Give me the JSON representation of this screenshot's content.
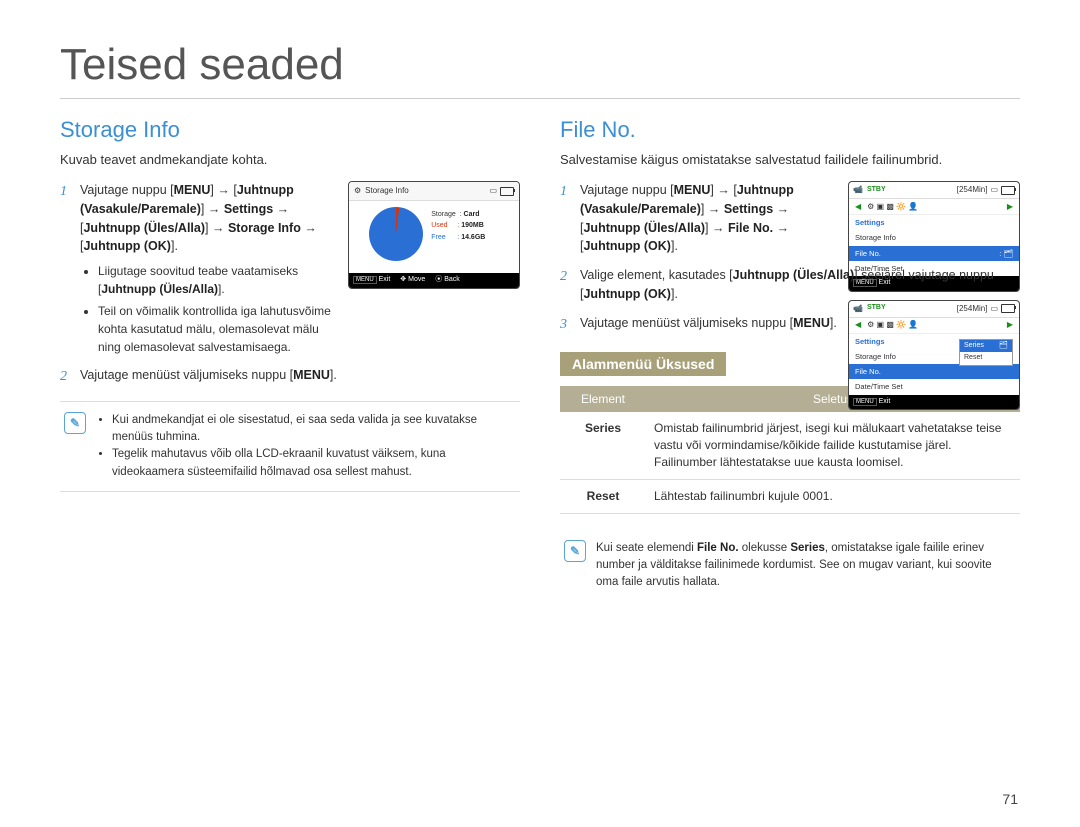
{
  "page_title": "Teised seaded",
  "page_number": "71",
  "left": {
    "heading": "Storage Info",
    "desc": "Kuvab teavet andmekandjate kohta.",
    "step1_a": "Vajutage nuppu [",
    "step1_menu": "MENU",
    "step1_b": "] → [",
    "step1_ctrl": "Juhtnupp (Vasakule/Paremale)",
    "step1_c": "] → ",
    "step1_settings": "Settings",
    "step1_d": " → [",
    "step1_ctrl2": "Juhtnupp (Üles/Alla)",
    "step1_e": "] → ",
    "step1_storage": "Storage Info",
    "step1_f": " → [",
    "step1_ok": "Juhtnupp (OK)",
    "step1_g": "].",
    "bullet1_a": "Liigutage soovitud teabe vaatamiseks [",
    "bullet1_b": "Juhtnupp (Üles/Alla)",
    "bullet1_c": "].",
    "bullet2": "Teil on võimalik kontrollida iga lahutusvõime kohta kasutatud mälu, olemasolevat mälu ning olemasolevat salvestamisaega.",
    "step2_a": "Vajutage menüüst väljumiseks nuppu [",
    "step2_menu": "MENU",
    "step2_b": "].",
    "note1": "Kui andmekandjat ei ole sisestatud, ei saa seda valida ja see kuvatakse menüüs tuhmina.",
    "note2": "Tegelik mahutavus võib olla LCD-ekraanil kuvatust väiksem, kuna videokaamera süsteemifailid hõlmavad osa sellest mahust.",
    "lcd": {
      "title": "Storage Info",
      "storage_label": "Storage",
      "storage_value": "Card",
      "used_label": "Used",
      "used_value": "190MB",
      "free_label": "Free",
      "free_value": "14.6GB",
      "footer_exit": "Exit",
      "footer_move": "Move",
      "footer_back": "Back",
      "menu_chip": "MENU"
    }
  },
  "right": {
    "heading": "File No.",
    "desc": "Salvestamise käigus omistatakse salvestatud failidele failinumbrid.",
    "step1_a": "Vajutage nuppu [",
    "step1_menu": "MENU",
    "step1_b": "] → [",
    "step1_ctrl": "Juhtnupp (Vasakule/Paremale)",
    "step1_c": "] → ",
    "step1_settings": "Settings",
    "step1_d": " → [",
    "step1_ctrl2": "Juhtnupp (Üles/Alla)",
    "step1_e": "] → ",
    "step1_fileno": "File No.",
    "step1_f": " → [",
    "step1_ok": "Juhtnupp (OK)",
    "step1_g": "].",
    "step2_a": "Valige element, kasutades [",
    "step2_ctrl": "Juhtnupp (Üles/Alla)",
    "step2_b": "] seejärel vajutage nuppu [",
    "step2_ok": "Juhtnupp (OK)",
    "step2_c": "].",
    "step3_a": "Vajutage menüüst väljumiseks nuppu [",
    "step3_menu": "MENU",
    "step3_b": "].",
    "submenu_heading": "Alammenüü Üksused",
    "table": {
      "h1": "Element",
      "h2": "Seletus",
      "r1c1": "Series",
      "r1c2": "Omistab failinumbrid järjest, isegi kui mälukaart vahetatakse teise vastu või vormindamise/kõikide failide kustutamise järel. Failinumber lähtestatakse uue kausta loomisel.",
      "r2c1": "Reset",
      "r2c2": "Lähtestab failinumbri kujule 0001."
    },
    "note_a": "Kui seate elemendi ",
    "note_b": "File No.",
    "note_c": " olekusse ",
    "note_d": "Series",
    "note_e": ", omistatakse igale failile erinev number ja välditakse failinimede kordumist. See on mugav variant, kui soovite oma faile arvutis hallata.",
    "lcd1": {
      "stby": "STBY",
      "time": "[254Min]",
      "settings": "Settings",
      "storage_info": "Storage Info",
      "file_no": "File No.",
      "date_time": "Date/Time Set",
      "footer_exit": "Exit",
      "menu_chip": "MENU"
    },
    "lcd2": {
      "stby": "STBY",
      "time": "[254Min]",
      "settings": "Settings",
      "storage_info": "Storage Info",
      "file_no": "File No.",
      "date_time": "Date/Time Set",
      "popup_series": "Series",
      "popup_reset": "Reset",
      "footer_exit": "Exit",
      "menu_chip": "MENU"
    }
  }
}
